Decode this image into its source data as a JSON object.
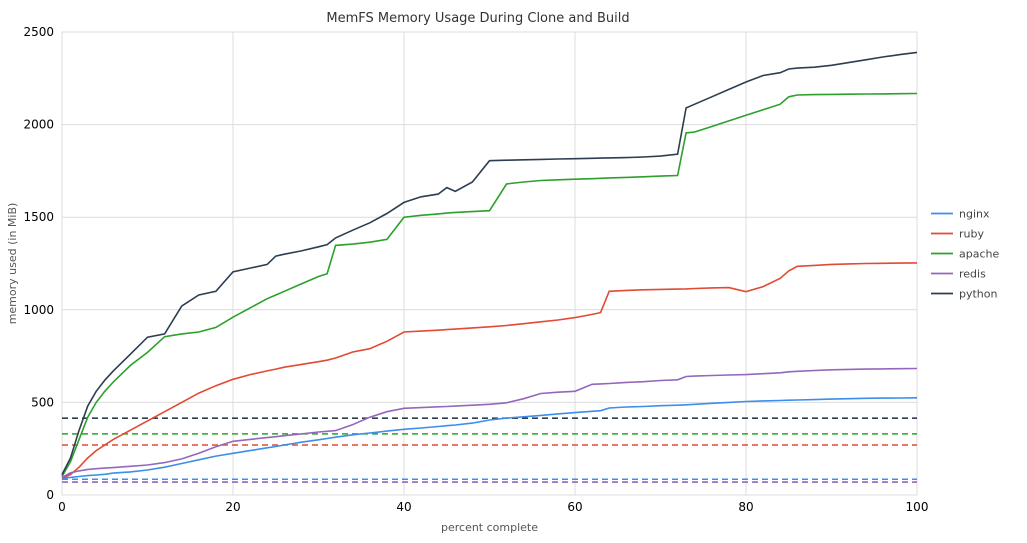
{
  "chart_data": {
    "type": "line",
    "title": "MemFS Memory Usage During Clone and Build",
    "xlabel": "percent complete",
    "ylabel": "memory used (in MiB)",
    "xlim": [
      0,
      100
    ],
    "ylim": [
      0,
      2500
    ],
    "xticks": [
      0,
      20,
      40,
      60,
      80,
      100
    ],
    "yticks": [
      0,
      500,
      1000,
      1500,
      2000,
      2500
    ],
    "x": [
      0,
      1,
      2,
      3,
      4,
      5,
      6,
      8,
      10,
      12,
      14,
      16,
      18,
      20,
      22,
      24,
      25,
      26,
      28,
      30,
      31,
      32,
      34,
      36,
      38,
      40,
      42,
      44,
      45,
      46,
      48,
      50,
      52,
      54,
      56,
      58,
      60,
      62,
      63,
      64,
      66,
      68,
      70,
      72,
      73,
      74,
      76,
      78,
      80,
      82,
      84,
      85,
      86,
      88,
      90,
      92,
      94,
      96,
      98,
      100
    ],
    "series": [
      {
        "name": "nginx",
        "color": "#3b8eea",
        "values": [
          92,
          95,
          100,
          105,
          108,
          112,
          118,
          125,
          135,
          150,
          170,
          190,
          210,
          225,
          240,
          255,
          262,
          270,
          285,
          298,
          305,
          312,
          325,
          335,
          345,
          355,
          362,
          370,
          374,
          378,
          388,
          405,
          415,
          422,
          430,
          438,
          445,
          452,
          455,
          470,
          475,
          478,
          482,
          485,
          487,
          490,
          495,
          500,
          505,
          508,
          510,
          512,
          513,
          515,
          518,
          520,
          522,
          523,
          524,
          525
        ],
        "baseline": 85
      },
      {
        "name": "ruby",
        "color": "#e24a33",
        "values": [
          92,
          110,
          150,
          200,
          240,
          270,
          300,
          350,
          400,
          450,
          500,
          550,
          590,
          625,
          650,
          670,
          680,
          690,
          705,
          720,
          728,
          740,
          772,
          790,
          830,
          880,
          885,
          890,
          893,
          896,
          902,
          908,
          915,
          925,
          935,
          945,
          958,
          975,
          985,
          1100,
          1105,
          1108,
          1110,
          1112,
          1113,
          1115,
          1118,
          1120,
          1098,
          1125,
          1170,
          1210,
          1235,
          1240,
          1245,
          1248,
          1250,
          1251,
          1252,
          1253
        ],
        "baseline": 270
      },
      {
        "name": "apache",
        "color": "#2ca02c",
        "values": [
          100,
          180,
          300,
          420,
          500,
          560,
          610,
          700,
          770,
          855,
          870,
          880,
          905,
          960,
          1010,
          1060,
          1080,
          1100,
          1140,
          1180,
          1195,
          1348,
          1355,
          1365,
          1380,
          1500,
          1510,
          1518,
          1522,
          1526,
          1530,
          1535,
          1680,
          1690,
          1698,
          1702,
          1705,
          1708,
          1710,
          1712,
          1715,
          1718,
          1722,
          1725,
          1955,
          1960,
          1990,
          2020,
          2050,
          2080,
          2110,
          2150,
          2160,
          2162,
          2163,
          2164,
          2165,
          2166,
          2167,
          2168
        ],
        "baseline": 330
      },
      {
        "name": "redis",
        "color": "#9467bd",
        "values": [
          95,
          120,
          130,
          138,
          142,
          145,
          148,
          155,
          162,
          175,
          195,
          225,
          260,
          290,
          300,
          310,
          315,
          320,
          330,
          340,
          344,
          348,
          380,
          420,
          450,
          468,
          472,
          476,
          478,
          480,
          485,
          490,
          498,
          520,
          548,
          555,
          560,
          598,
          600,
          602,
          608,
          612,
          618,
          622,
          640,
          642,
          645,
          648,
          650,
          655,
          660,
          665,
          668,
          672,
          676,
          678,
          680,
          681,
          682,
          683
        ],
        "baseline": 70
      },
      {
        "name": "python",
        "color": "#2c3e50",
        "values": [
          110,
          200,
          350,
          480,
          560,
          620,
          670,
          760,
          852,
          870,
          1020,
          1080,
          1100,
          1205,
          1225,
          1245,
          1290,
          1300,
          1318,
          1340,
          1352,
          1388,
          1430,
          1470,
          1520,
          1580,
          1610,
          1625,
          1660,
          1640,
          1690,
          1805,
          1808,
          1810,
          1812,
          1814,
          1816,
          1818,
          1819,
          1820,
          1822,
          1825,
          1830,
          1840,
          2090,
          2110,
          2150,
          2190,
          2230,
          2265,
          2280,
          2300,
          2305,
          2310,
          2320,
          2335,
          2350,
          2365,
          2378,
          2390
        ],
        "baseline": 415
      }
    ],
    "legend_entries": [
      "nginx",
      "ruby",
      "apache",
      "redis",
      "python"
    ]
  }
}
